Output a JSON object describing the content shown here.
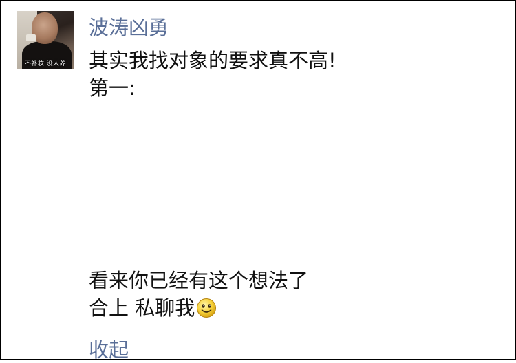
{
  "post": {
    "avatar_caption": "不补妆 没人养",
    "username": "波涛凶勇",
    "lines": [
      "其实我找对象的要求真不高!",
      "第一:",
      "看来你已经有这个想法了",
      "合上 私聊我"
    ],
    "emoji_icon": "smiley-face-icon",
    "collapse_label": "收起"
  },
  "colors": {
    "username": "#5a6f98",
    "text": "#111111",
    "link": "#5a6f98",
    "border": "#000000"
  }
}
